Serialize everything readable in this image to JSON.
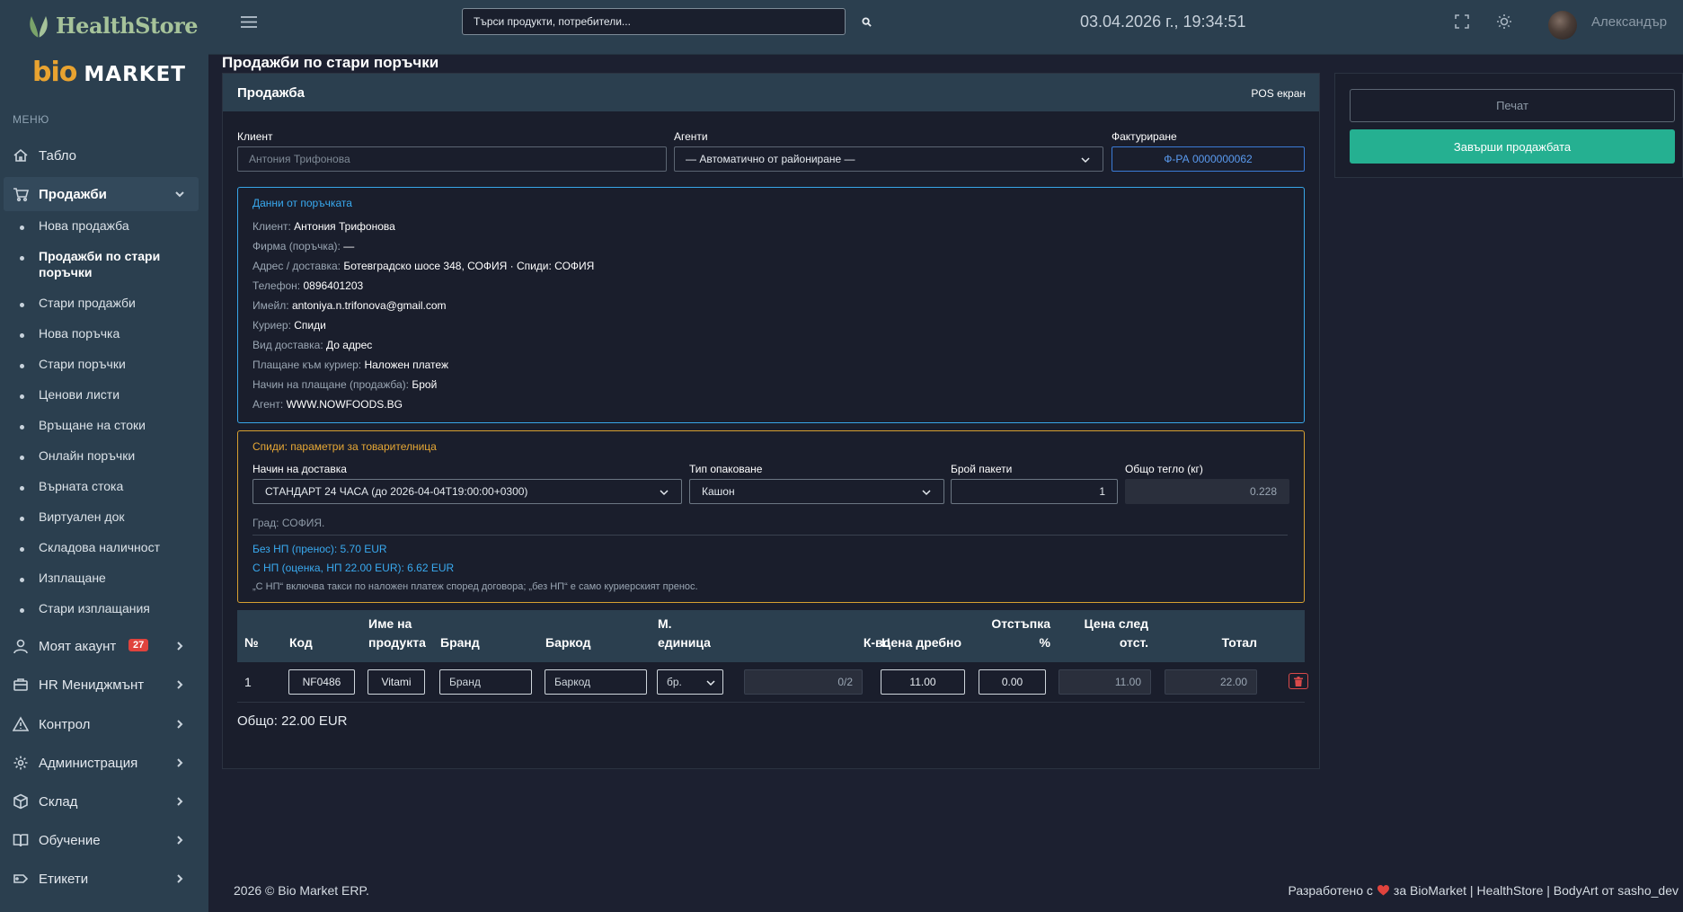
{
  "brand": {
    "healthstore": "HealthStore",
    "bio": "bio",
    "market": "MARKET"
  },
  "sidebar": {
    "menu_title": "МЕНЮ",
    "items": [
      {
        "label": "Табло",
        "icon": "home-icon"
      },
      {
        "label": "Продажби",
        "icon": "cart-icon"
      },
      {
        "label": "Моят акаунт",
        "icon": "user-icon",
        "badge": "27"
      },
      {
        "label": "HR Мениджмънт",
        "icon": "briefcase-icon"
      },
      {
        "label": "Контрол",
        "icon": "warning-icon"
      },
      {
        "label": "Администрация",
        "icon": "gear-icon"
      },
      {
        "label": "Склад",
        "icon": "box-icon"
      },
      {
        "label": "Обучение",
        "icon": "book-icon"
      },
      {
        "label": "Етикети",
        "icon": "tag-icon"
      }
    ],
    "sub_items": [
      "Нова продажба",
      "Продажби по стари поръчки",
      "Стари продажби",
      "Нова поръчка",
      "Стари поръчки",
      "Ценови листи",
      "Връщане на стоки",
      "Онлайн поръчки",
      "Върната стока",
      "Виртуален док",
      "Складова наличност",
      "Изплащане",
      "Стари изплащания"
    ]
  },
  "topbar": {
    "search_placeholder": "Търси продукти, потребители...",
    "datetime": "03.04.2026 г., 19:34:51",
    "username": "Александър"
  },
  "page": {
    "title": "Продажби по стари поръчки"
  },
  "sale": {
    "header": "Продажба",
    "pos_link": "POS екран",
    "client_label": "Клиент",
    "client_value": "Антония Трифонова",
    "agents_label": "Агенти",
    "agents_value": "— Автоматично от райониране —",
    "invoicing_label": "Фактуриране",
    "invoicing_value": "Ф-РА 0000000062"
  },
  "order_data": {
    "title": "Данни от поръчката",
    "rows": [
      {
        "label": "Клиент:",
        "value": "Антония Трифонова"
      },
      {
        "label": "Фирма (поръчка):",
        "value": "—"
      },
      {
        "label": "Адрес / доставка:",
        "value": "Ботевградско шосе 348, СОФИЯ · Спиди: СОФИЯ"
      },
      {
        "label": "Телефон:",
        "value": "0896401203"
      },
      {
        "label": "Имейл:",
        "value": "antoniya.n.trifonova@gmail.com"
      },
      {
        "label": "Куриер:",
        "value": "Спиди"
      },
      {
        "label": "Вид доставка:",
        "value": "До адрес"
      },
      {
        "label": "Плащане към куриер:",
        "value": "Наложен платеж"
      },
      {
        "label": "Начин на плащане (продажба):",
        "value": "Брой"
      },
      {
        "label": "Агент:",
        "value": "WWW.NOWFOODS.BG"
      }
    ]
  },
  "speedy": {
    "title": "Спиди: параметри за товарителница",
    "delivery_label": "Начин на доставка",
    "delivery_value": "СТАНДАРТ 24 ЧАСА (до 2026-04-04T19:00:00+0300)",
    "packing_label": "Тип опаковане",
    "packing_value": "Кашон",
    "packages_label": "Брой пакети",
    "packages_value": "1",
    "weight_label": "Общо тегло (кг)",
    "weight_value": "0.228",
    "city": "Град: СОФИЯ.",
    "price_no_cod": "Без НП (пренос): 5.70 EUR",
    "price_cod": "С НП (оценка, НП 22.00 EUR): 6.62 EUR",
    "note": "„С НП“ включва такси по наложен платеж според договора; „без НП“ е само куриерският пренос."
  },
  "table": {
    "headers": {
      "num": "№",
      "code": "Код",
      "name_1": "Име на",
      "name_2": "продукта",
      "brand": "Бранд",
      "barcode": "Баркод",
      "unit_1": "М.",
      "unit_2": "единица",
      "qty": "К-во",
      "retail": "Цена дребно",
      "discount_1": "Отстъпка",
      "discount_2": "%",
      "after_1": "Цена след",
      "after_2": "отст.",
      "total": "Тотал"
    },
    "rows": [
      {
        "num": "1",
        "code": "NF0486",
        "name": "Vitami",
        "brand": "Бранд",
        "barcode": "Баркод",
        "unit": "бр.",
        "qty": "0/2",
        "retail": "11.00",
        "discount": "0.00",
        "after": "11.00",
        "total": "22.00"
      }
    ]
  },
  "total": "Общо: 22.00 EUR",
  "actions": {
    "print": "Печат",
    "finish": "Завърши продажбата"
  },
  "footer": {
    "left": "2026 © Bio Market ERP.",
    "right_before": "Разработено с",
    "right_after": "за BioMarket | HealthStore | BodyArt от sasho_dev"
  },
  "colors": {
    "accent": "#25b091",
    "info": "#38a6e8",
    "warning": "#d6a031",
    "danger": "#d94a4a"
  }
}
